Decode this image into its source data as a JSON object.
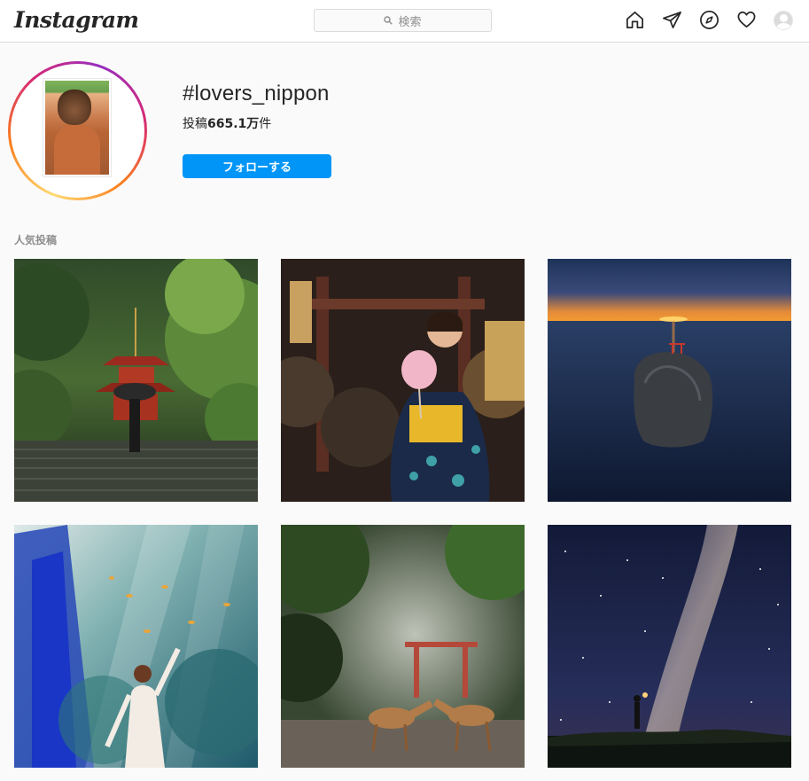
{
  "header": {
    "logo": "Instagram",
    "search_placeholder": "検索"
  },
  "nav_icons": [
    "home-icon",
    "direct-icon",
    "explore-icon",
    "activity-heart-icon",
    "profile-avatar"
  ],
  "tag": {
    "title": "#lovers_nippon",
    "posts_prefix": "投稿",
    "posts_count": "665.1万",
    "posts_suffix": "件",
    "follow_label": "フォローする"
  },
  "section": {
    "top_posts_label": "人気投稿"
  },
  "posts": [
    {
      "subject": "temple-pagoda-umbrella"
    },
    {
      "subject": "yukata-girl-cotton-candy"
    },
    {
      "subject": "sunset-torii-rock-sea"
    },
    {
      "subject": "aquarium-woman"
    },
    {
      "subject": "deer-torii"
    },
    {
      "subject": "milky-way-lantern"
    }
  ],
  "colors": {
    "accent": "#0095f6",
    "border": "#dbdbdb",
    "muted": "#8e8e8e",
    "text": "#262626"
  }
}
